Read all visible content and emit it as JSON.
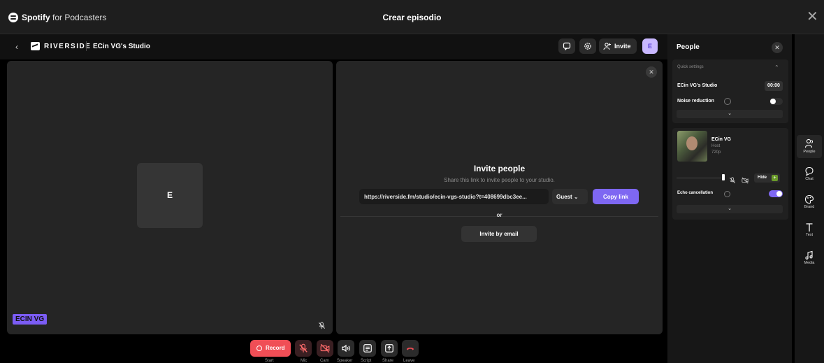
{
  "dialog": {
    "brand": "Spotify",
    "brand_suffix": "for Podcasters",
    "title": "Crear episodio",
    "close_glyph": "✕"
  },
  "studio_header": {
    "back_glyph": "‹",
    "logo_text": "RIVERSIDE",
    "studio_name": "ECin VG's Studio",
    "invite_label": "Invite",
    "avatar_letter": "E"
  },
  "video": {
    "avatar_letter": "E",
    "name_tag": "ECIN VG"
  },
  "invite": {
    "close_glyph": "✕",
    "title": "Invite people",
    "subtitle": "Share this link to invite people to your studio.",
    "link": "https://riverside.fm/studio/ecin-vgs-studio?t=408699dbc3ee...",
    "role": "Guest ⌄",
    "copy_label": "Copy link",
    "or_text": "or",
    "email_label": "Invite by email"
  },
  "toolbar": {
    "record_label": "Record",
    "labels": [
      "Start",
      "Mic",
      "Cam",
      "Speaker",
      "Script",
      "Share",
      "Leave"
    ]
  },
  "people": {
    "title": "People",
    "close_glyph": "✕",
    "quick_settings": "Quick settings",
    "collapse_glyph": "⌃",
    "studio_name": "ECin VG's Studio",
    "timer": "00:00",
    "noise_reduction": "Noise reduction",
    "expand_glyph": "⌄",
    "noise_reduction_on": false,
    "host": {
      "name": "ECin VG",
      "role": "Host",
      "resolution": "720p",
      "hide_label": "Hide",
      "hide_plus": "+"
    },
    "echo_cancellation": "Echo cancellation",
    "echo_cancellation_on": true
  },
  "rail": {
    "items": [
      "People",
      "Chat",
      "Brand",
      "Text",
      "Media"
    ],
    "active": "People"
  },
  "colors": {
    "accent": "#7e67f2",
    "record": "#f04e56",
    "name_tag": "#7b5cf5"
  }
}
